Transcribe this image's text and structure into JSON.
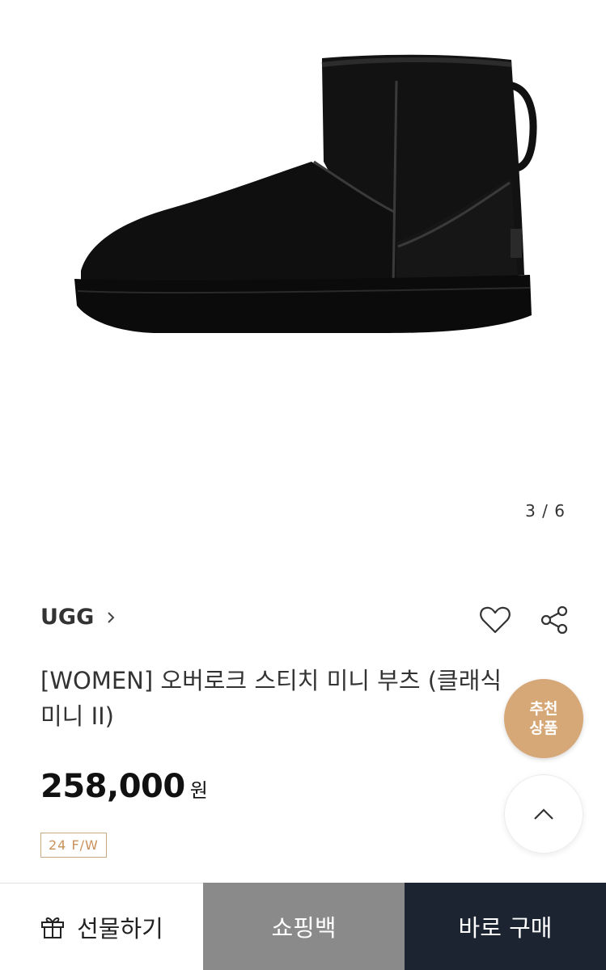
{
  "gallery": {
    "pager": "3 / 6",
    "image_alt": "black mini boot"
  },
  "product": {
    "brand": "UGG",
    "title": "[WOMEN] 오버로크 스티치 미니 부츠 (클래식 미니 II)",
    "price": "258,000",
    "currency": "원",
    "season_tag": "24 F/W"
  },
  "icons": {
    "brand_link": "chevron-right-icon",
    "wishlist": "heart-icon",
    "share": "share-icon",
    "scroll_top": "chevron-up-icon",
    "gift": "gift-icon"
  },
  "floating": {
    "recommend_label": "추천 상품"
  },
  "bottom_bar": {
    "gift_label": "선물하기",
    "bag_label": "쇼핑백",
    "buy_label": "바로 구매"
  },
  "colors": {
    "recommend_bg": "#d6a877",
    "bag_bg": "#8a8a8a",
    "buy_bg": "#1b2430",
    "season_border": "#c9a882"
  }
}
